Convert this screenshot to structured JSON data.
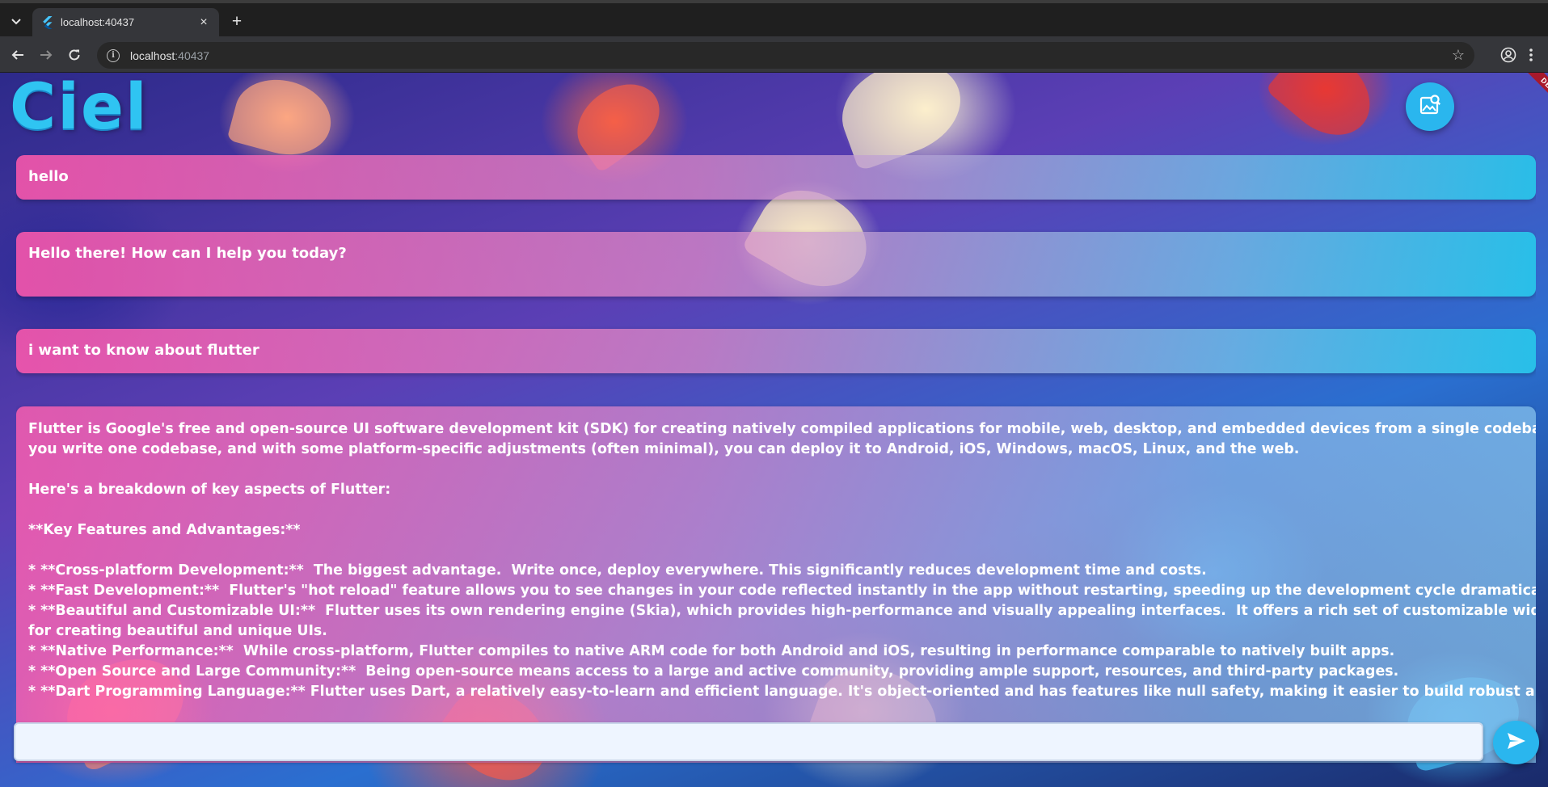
{
  "browser": {
    "tab_title": "localhost:40437",
    "tab_close_glyph": "×",
    "new_tab_glyph": "+",
    "url_host": "localhost",
    "url_port": ":40437",
    "icons": {
      "tab_list": "chevron-down-icon",
      "favicon": "flutter-logo-icon",
      "back": "arrow-left-icon",
      "forward": "arrow-right-icon",
      "reload": "reload-icon",
      "site_info": "info-icon",
      "bookmark": "star-icon",
      "profile": "account-circle-icon",
      "menu": "more-vert-icon"
    }
  },
  "app": {
    "logo_text": "Ciel",
    "debug_label": "DEBUG",
    "colors": {
      "accent": "#2ab6ee",
      "bubble_start": "#ff58ac",
      "bubble_end": "#28c8eb",
      "input_bg": "#eef5ff"
    },
    "fab_icon": "image-search-icon",
    "send_icon": "send-icon",
    "input": {
      "value": "",
      "placeholder": ""
    },
    "messages": [
      {
        "role": "user",
        "text": "hello"
      },
      {
        "role": "assistant",
        "text": "Hello there! How can I help you today?"
      },
      {
        "role": "user",
        "text": "i want to know about flutter"
      },
      {
        "role": "assistant",
        "lines": [
          "Flutter is Google's free and open-source UI software development kit (SDK) for creating natively compiled applications for mobile, web, desktop, and embedded devices from a single codebase.  That means",
          "you write one codebase, and with some platform-specific adjustments (often minimal), you can deploy it to Android, iOS, Windows, macOS, Linux, and the web.",
          "",
          "Here's a breakdown of key aspects of Flutter:",
          "",
          "**Key Features and Advantages:**",
          "",
          "* **Cross-platform Development:**  The biggest advantage.  Write once, deploy everywhere. This significantly reduces development time and costs.",
          "* **Fast Development:**  Flutter's \"hot reload\" feature allows you to see changes in your code reflected instantly in the app without restarting, speeding up the development cycle dramatically.",
          "* **Beautiful and Customizable UI:**  Flutter uses its own rendering engine (Skia), which provides high-performance and visually appealing interfaces.  It offers a rich set of customizable widgets that allow",
          "for creating beautiful and unique UIs.",
          "* **Native Performance:**  While cross-platform, Flutter compiles to native ARM code for both Android and iOS, resulting in performance comparable to natively built apps.",
          "* **Open Source and Large Community:**  Being open-source means access to a large and active community, providing ample support, resources, and third-party packages.",
          "* **Dart Programming Language:** Flutter uses Dart, a relatively easy-to-learn and efficient language. It's object-oriented and has features like null safety, making it easier to build robust and maintainable"
        ]
      }
    ]
  }
}
